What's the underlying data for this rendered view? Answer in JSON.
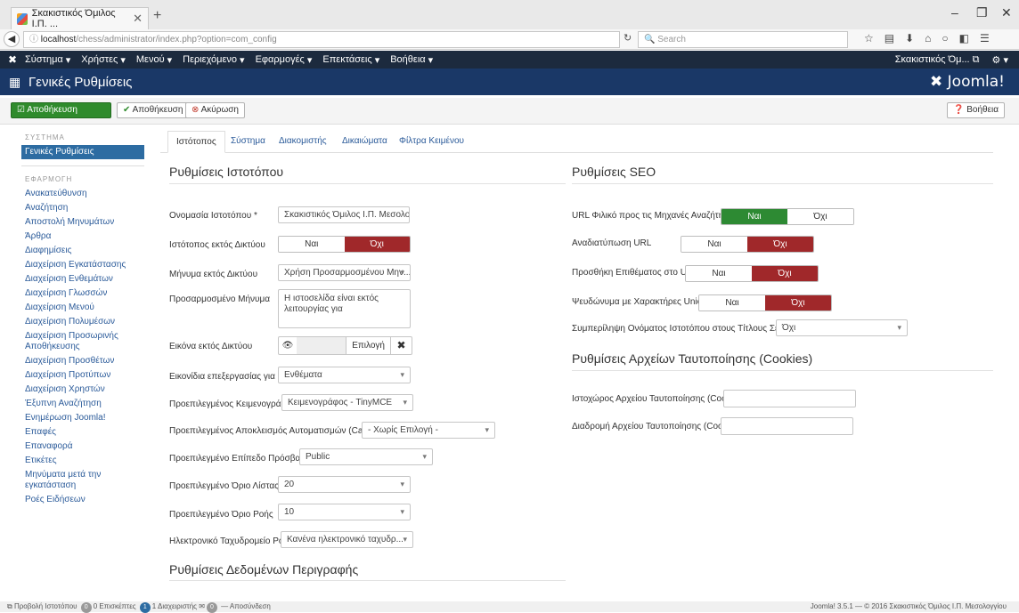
{
  "browser": {
    "tab_title": "Σκακιστικός Όμιλος Ι.Π. ...",
    "url_host": "localhost",
    "url_path": "/chess/administrator/index.php?option=com_config",
    "search_placeholder": "Search"
  },
  "nav": {
    "menus": [
      "Σύστημα",
      "Χρήστες",
      "Μενού",
      "Περιεχόμενο",
      "Εφαρμογές",
      "Επεκτάσεις",
      "Βοήθεια"
    ],
    "site_link": "Σκακιστικός Όμ..."
  },
  "header": {
    "title": "Γενικές Ρυθμίσεις",
    "brand": "Joomla!"
  },
  "toolbar": {
    "save_close": "Αποθήκευση",
    "save": "Αποθήκευση",
    "cancel": "Ακύρωση",
    "help": "Βοήθεια"
  },
  "sidebar": {
    "system_head": "ΣΥΣΤΗΜΑ",
    "system_items": [
      "Γενικές Ρυθμίσεις"
    ],
    "app_head": "ΕΦΑΡΜΟΓΗ",
    "app_items": [
      "Ανακατεύθυνση",
      "Αναζήτηση",
      "Αποστολή Μηνυμάτων",
      "Άρθρα",
      "Διαφημίσεις",
      "Διαχείριση Εγκατάστασης",
      "Διαχείριση Ενθεμάτων",
      "Διαχείριση Γλωσσών",
      "Διαχείριση Μενού",
      "Διαχείριση Πολυμέσων",
      "Διαχείριση Προσωρινής Αποθήκευσης",
      "Διαχείριση Προσθέτων",
      "Διαχείριση Προτύπων",
      "Διαχείριση Χρηστών",
      "Έξυπνη Αναζήτηση",
      "Ενημέρωση Joomla!",
      "Επαφές",
      "Επαναφορά",
      "Ετικέτες",
      "Μηνύματα μετά την εγκατάσταση",
      "Ροές Ειδήσεων"
    ]
  },
  "tabs": [
    "Ιστότοπος",
    "Σύστημα",
    "Διακομιστής",
    "Δικαιώματα",
    "Φίλτρα Κειμένου"
  ],
  "site": {
    "heading": "Ρυθμίσεις Ιστοτόπου",
    "site_name_label": "Ονομασία Ιστοτόπου *",
    "site_name_value": "Σκακιστικός Όμιλος Ι.Π. Μεσολογγί",
    "offline_label": "Ιστότοπος εκτός Δικτύου",
    "offline_message_label": "Μήνυμα εκτός Δικτύου",
    "offline_message_value": "Χρήση Προσαρμοσμένου Μην...",
    "custom_message_label": "Προσαρμοσμένο Μήνυμα",
    "custom_message_value": "Η ιστοσελίδα είναι εκτός λειτουργίας για",
    "offline_image_label": "Εικόνα εκτός Δικτύου",
    "select_btn": "Επιλογή",
    "edit_icons_label": "Εικονίδια επεξεργασίας για",
    "edit_icons_value": "Ενθέματα",
    "editor_label": "Προεπιλεγμένος Κειμενογράφος",
    "editor_value": "Κειμενογράφος - TinyMCE",
    "captcha_label": "Προεπιλεγμένος Αποκλεισμός Αυτοματισμών (Captcha)",
    "captcha_value": "- Χωρίς Επιλογή -",
    "access_label": "Προεπιλεγμένο Επίπεδο Πρόσβασης",
    "access_value": "Public",
    "list_limit_label": "Προεπιλεγμένο Όριο Λίστας",
    "list_limit_value": "20",
    "feed_limit_label": "Προεπιλεγμένο Όριο Ροής",
    "feed_limit_value": "10",
    "feed_email_label": "Ηλεκτρονικό Ταχυδρομείο Ροής",
    "feed_email_value": "Κανένα ηλεκτρονικό ταχυδρ..."
  },
  "metadata_heading": "Ρυθμίσεις Δεδομένων Περιγραφής",
  "seo": {
    "heading": "Ρυθμίσεις SEO",
    "sef_label": "URL Φιλικό προς τις Μηχανές Αναζήτησης",
    "rewrite_label": "Αναδιατύπωση URL",
    "suffix_label": "Προσθήκη Επιθέματος στο URL",
    "unicode_label": "Ψευδώνυμα με Χαρακτήρες Unicode",
    "sitename_pages_label": "Συμπερίληψη Ονόματος Ιστοτόπου στους Τίτλους Σελίδων",
    "sitename_pages_value": "Όχι"
  },
  "cookies": {
    "heading": "Ρυθμίσεις Αρχείων Ταυτοποίησης (Cookies)",
    "domain_label": "Ιστοχώρος Αρχείου Ταυτοποίησης (Cookie)",
    "path_label": "Διαδρομή Αρχείου Ταυτοποίησης (Cookie)"
  },
  "toggle": {
    "yes": "Ναι",
    "no": "Όχι"
  },
  "status": {
    "view_site": "Προβολή Ιστοτόπου",
    "visitors_count": "0",
    "visitors": "0 Επισκέπτες",
    "admins_count": "1",
    "admins": "1 Διαχειριστής",
    "msgs_count": "0",
    "logout": "Αποσύνδεση",
    "footer": "Joomla! 3.5.1 — © 2016 Σκακιστικός Όμιλος Ι.Π. Μεσολογγίου"
  }
}
